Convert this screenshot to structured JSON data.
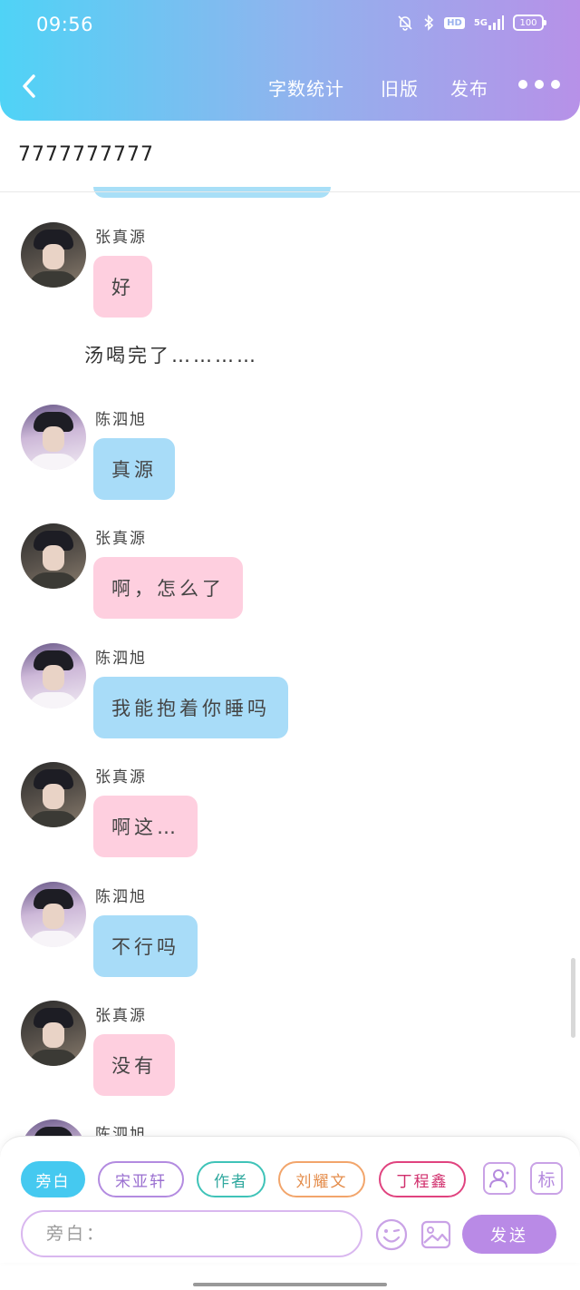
{
  "status_bar": {
    "time": "09:56",
    "hd": "HD",
    "network": "5G",
    "battery": "100"
  },
  "header": {
    "word_count_label": "字数统计",
    "old_version_label": "旧版",
    "publish_label": "发布"
  },
  "doc": {
    "title": "7777777777"
  },
  "chat": {
    "messages": [
      {
        "speaker": "张真源",
        "text": "好"
      },
      {
        "narration": "汤喝完了…………"
      },
      {
        "speaker": "陈泗旭",
        "text": "真源"
      },
      {
        "speaker": "张真源",
        "text": "啊，怎么了"
      },
      {
        "speaker": "陈泗旭",
        "text": "我能抱着你睡吗"
      },
      {
        "speaker": "张真源",
        "text": "啊这…"
      },
      {
        "speaker": "陈泗旭",
        "text": "不行吗"
      },
      {
        "speaker": "张真源",
        "text": "没有"
      },
      {
        "speaker": "陈泗旭"
      }
    ]
  },
  "role_chips": [
    {
      "label": "旁白",
      "color": "#45c9f0"
    },
    {
      "label": "宋亚轩",
      "color": "#b38be0"
    },
    {
      "label": "作者",
      "color": "#3fc3b8"
    },
    {
      "label": "刘耀文",
      "color": "#f2a56b"
    },
    {
      "label": "丁程鑫",
      "color": "#e0437f"
    }
  ],
  "toolbar": {
    "tag_label": "标"
  },
  "composer": {
    "placeholder": "旁白：",
    "send_label": "发送"
  },
  "colors": {
    "header_start": "#4fd3f6",
    "header_end": "#b791e8",
    "pink_bubble": "#fecfdf",
    "blue_bubble": "#a8dcf8",
    "send": "#b98ae6"
  },
  "icons": [
    "back-icon",
    "mute-bell-icon",
    "bluetooth-icon",
    "signal-icon",
    "battery-icon",
    "more-icon",
    "add-character-icon",
    "emoji-icon",
    "image-icon"
  ]
}
